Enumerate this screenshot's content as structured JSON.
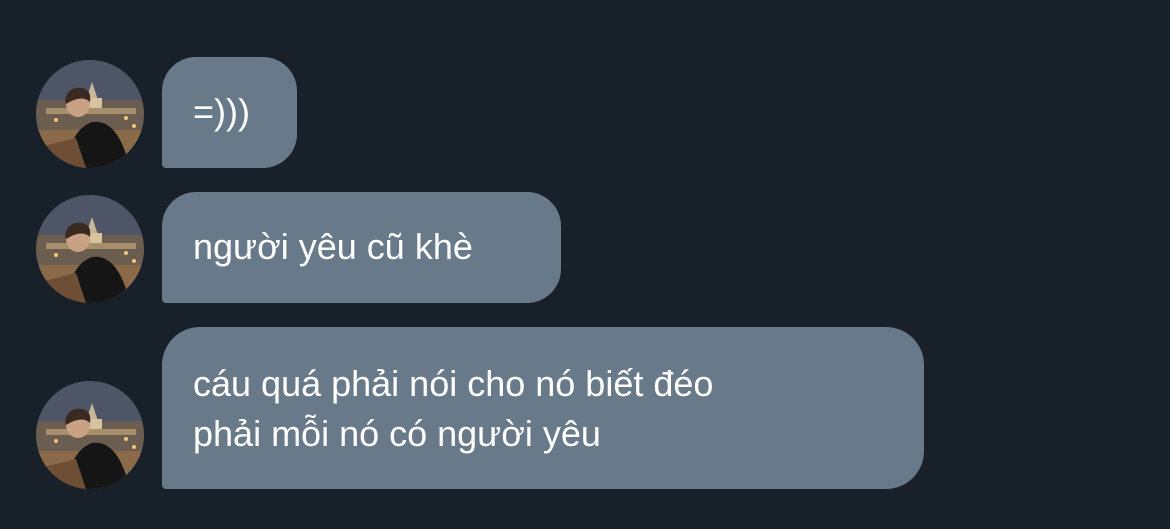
{
  "conversation": {
    "messages": [
      {
        "sender_avatar": "profile-photo",
        "text": "=)))"
      },
      {
        "sender_avatar": "profile-photo",
        "text": "người yêu cũ khè"
      },
      {
        "sender_avatar": "profile-photo",
        "text": "cáu quá phải nói cho nó biết đéo\nphải mỗi nó có người yêu"
      }
    ]
  },
  "colors": {
    "background": "#18202a",
    "bubble": "#687a89",
    "text": "#ffffff"
  }
}
